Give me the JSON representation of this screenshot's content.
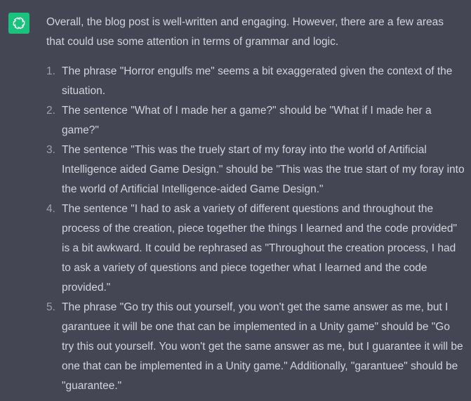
{
  "assistant": {
    "avatar_icon": "openai-logo-icon",
    "avatar_color": "#19c37d"
  },
  "message": {
    "intro": "Overall, the blog post is well-written and engaging. However, there are a few areas that could use some attention in terms of grammar and logic.",
    "items": [
      {
        "number": "1.",
        "text": "The phrase \"Horror engulfs me\" seems a bit exaggerated given the context of the situation."
      },
      {
        "number": "2.",
        "text": "The sentence \"What of I made her a game?\" should be \"What if I made her a game?\""
      },
      {
        "number": "3.",
        "text": "The sentence \"This was the truely start of my foray into the world of Artificial Intelligence aided Game Design.\" should be \"This was the true start of my foray into the world of Artificial Intelligence-aided Game Design.\""
      },
      {
        "number": "4.",
        "text": "The sentence \"I had to ask a variety of different questions and throughout the process of the creation, piece together the things I learned and the code provided\" is a bit awkward. It could be rephrased as \"Throughout the creation process, I had to ask a variety of questions and piece together what I learned and the code provided.\""
      },
      {
        "number": "5.",
        "text": "The phrase \"Go try this out yourself, you won't get the same answer as me, but I garantuee it will be one that can be implemented in a Unity game\" should be \"Go try this out yourself. You won't get the same answer as me, but I guarantee it will be one that can be implemented in a Unity game.\" Additionally, \"garantuee\" should be \"guarantee.\""
      }
    ]
  }
}
